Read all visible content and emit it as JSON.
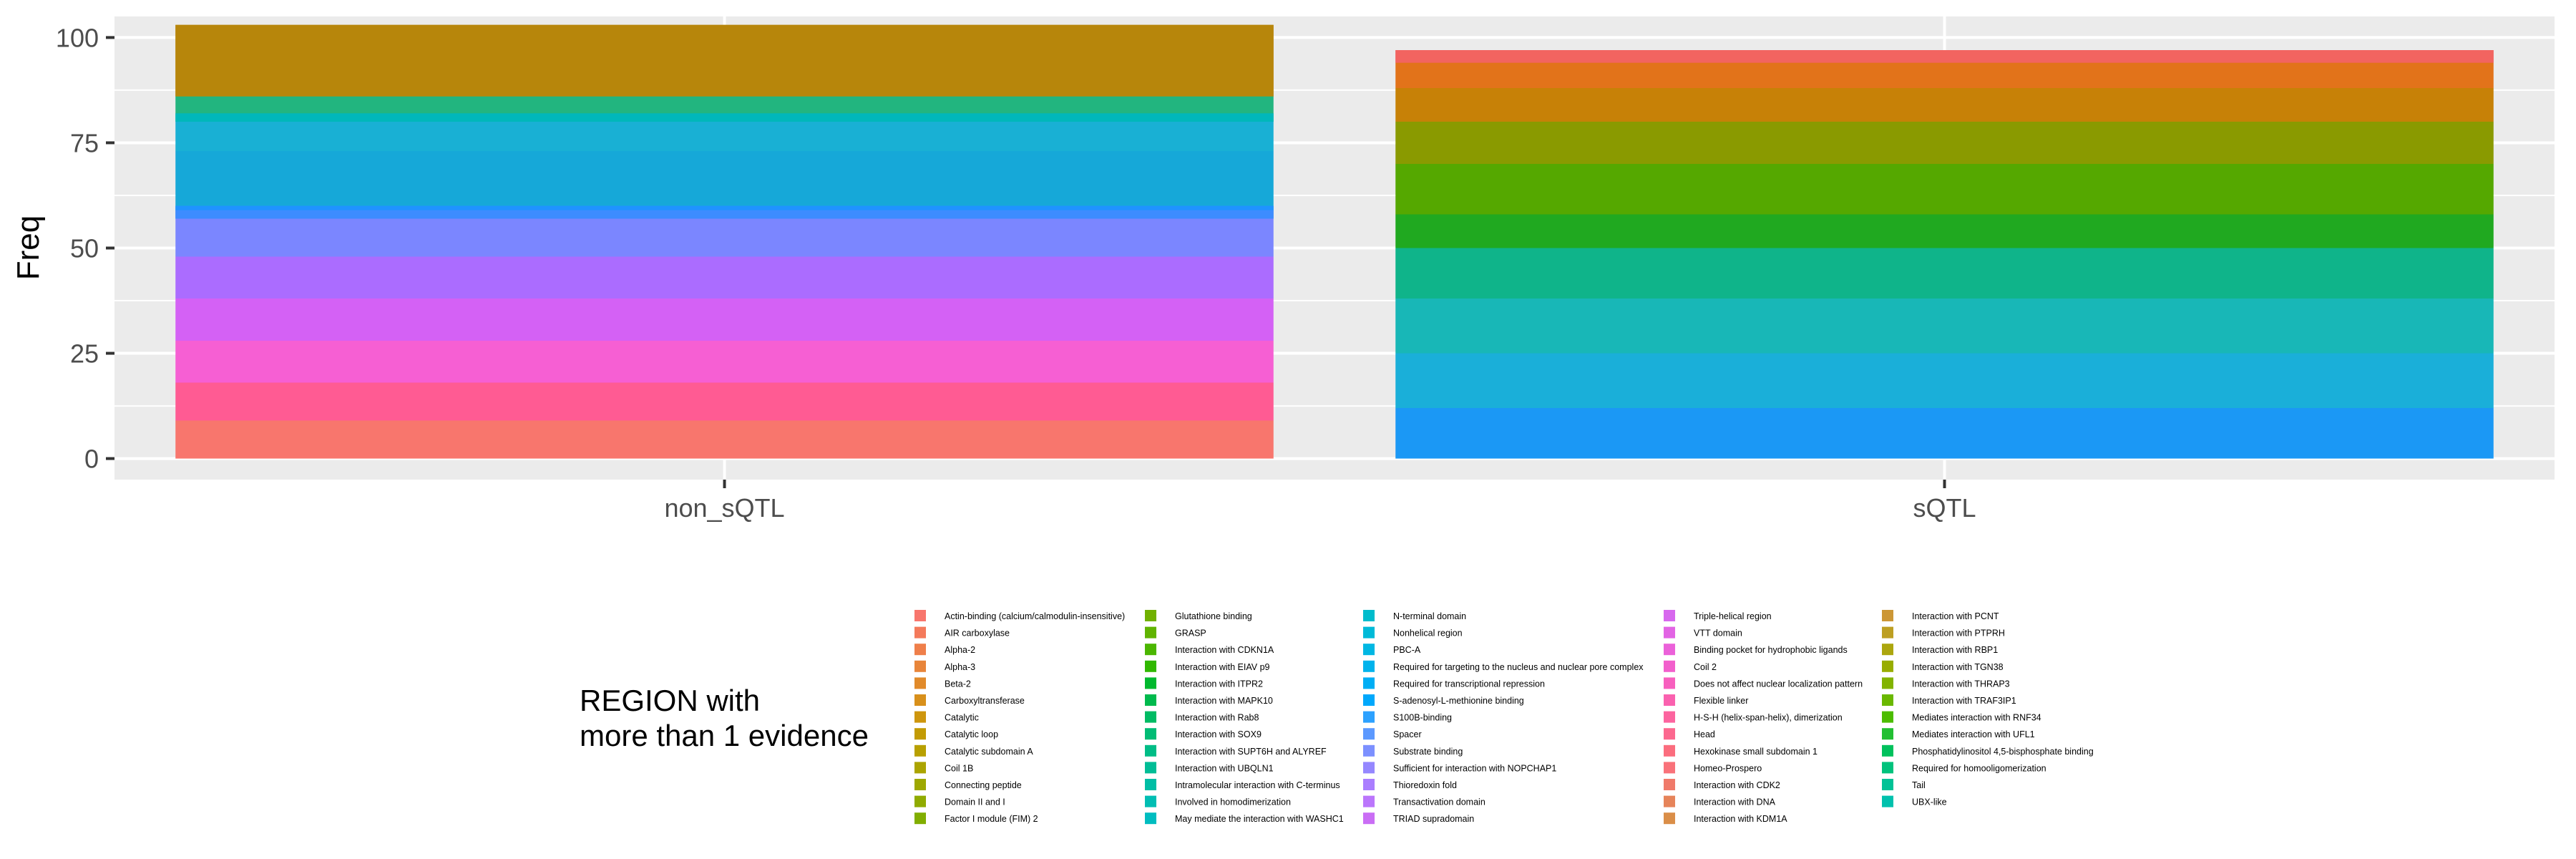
{
  "chart_data": {
    "type": "bar",
    "stacked": true,
    "title": "",
    "xlabel": "",
    "ylabel": "Freq",
    "ylim": [
      -5,
      105
    ],
    "yticks": [
      0,
      25,
      50,
      75,
      100
    ],
    "categories": [
      "non_sQTL",
      "sQTL"
    ],
    "totals": [
      103,
      97
    ],
    "grid": true,
    "legend_position": "bottom",
    "legend_title": "REGION with\nmore than 1 evidence",
    "legend_entries": [
      "Actin-binding (calcium/calmodulin-insensitive)",
      "AIR carboxylase",
      "Alpha-2",
      "Alpha-3",
      "Beta-2",
      "Carboxyltransferase",
      "Catalytic",
      "Catalytic loop",
      "Catalytic subdomain A",
      "Coil 1B",
      "Connecting peptide",
      "Domain II and I",
      "Factor I module (FIM) 2",
      "Glutathione binding",
      "GRASP",
      "Interaction with CDKN1A",
      "Interaction with EIAV p9",
      "Interaction with ITPR2",
      "Interaction with MAPK10",
      "Interaction with Rab8",
      "Interaction with SOX9",
      "Interaction with SUPT6H and ALYREF",
      "Interaction with UBQLN1",
      "Intramolecular interaction with C-terminus",
      "Involved in homodimerization",
      "May mediate the interaction with WASHC1",
      "N-terminal domain",
      "Nonhelical region",
      "PBC-A",
      "Required for targeting to the nucleus and nuclear pore complex",
      "Required for transcriptional repression",
      "S-adenosyl-L-methionine binding",
      "S100B-binding",
      "Spacer",
      "Substrate binding",
      "Sufficient for interaction with NOPCHAP1",
      "Thioredoxin fold",
      "Transactivation domain",
      "TRIAD supradomain",
      "Triple-helical region",
      "VTT domain",
      "Binding pocket for hydrophobic ligands",
      "Coil 2",
      "Does not affect nuclear localization pattern",
      "Flexible linker",
      "H-S-H (helix-span-helix), dimerization",
      "Head",
      "Hexokinase small subdomain 1",
      "Homeo-Prospero",
      "Interaction with CDK2",
      "Interaction with DNA",
      "Interaction with KDM1A",
      "Interaction with PCNT",
      "Interaction with PTPRH",
      "Interaction with RBP1",
      "Interaction with TGN38",
      "Interaction with THRAP3",
      "Interaction with TRAF3IP1",
      "Mediates interaction with RNF34",
      "Mediates interaction with UFL1",
      "Phosphatidylinositol 4,5-bisphosphate binding",
      "Required for homooligomerization",
      "Tail",
      "UBX-like"
    ],
    "legend_colors": [
      "#F8766D",
      "#F47A5B",
      "#EF7F4A",
      "#E8853A",
      "#E18A2A",
      "#D8901B",
      "#CE960D",
      "#C39B04",
      "#B8A000",
      "#ABA400",
      "#9EA800",
      "#90AB00",
      "#81AE00",
      "#71B100",
      "#60B400",
      "#4BB600",
      "#30B800",
      "#00B92E",
      "#00BA4D",
      "#00BB63",
      "#00BC75",
      "#00BD86",
      "#00BD96",
      "#00BEA5",
      "#00BEB3",
      "#00BDC0",
      "#00BCCC",
      "#00BAD8",
      "#00B7E3",
      "#00B3EC",
      "#00AEF5",
      "#00A8FC",
      "#2CA1FF",
      "#5C99FF",
      "#7C90FF",
      "#9587FF",
      "#AA7EFF",
      "#BB76FC",
      "#CA6EF5",
      "#D768EE",
      "#E264E4",
      "#EB61D9",
      "#F25FCC",
      "#F75FBE",
      "#FA61AF",
      "#FC649F",
      "#FC688F",
      "#FB6D7E",
      "#F9727A",
      "#F07A6A",
      "#E6845A",
      "#DA8E48",
      "#CC9736",
      "#BD9F22",
      "#ACA60E",
      "#98AD00",
      "#82B300",
      "#6AB800",
      "#4CBC00",
      "#22BF32",
      "#00C15C",
      "#00C27C",
      "#00C296",
      "#00C1AD"
    ],
    "segments": {
      "non_sQTL": [
        {
          "from": 0,
          "to": 9,
          "color": "#F8766D"
        },
        {
          "from": 9,
          "to": 18,
          "color": "#FF5B93"
        },
        {
          "from": 18,
          "to": 28,
          "color": "#F65FD3"
        },
        {
          "from": 28,
          "to": 38,
          "color": "#D461F5"
        },
        {
          "from": 38,
          "to": 48,
          "color": "#AB6CFF"
        },
        {
          "from": 48,
          "to": 57,
          "color": "#7B86FF"
        },
        {
          "from": 57,
          "to": 59,
          "color": "#3D8CFF"
        },
        {
          "from": 59,
          "to": 60,
          "color": "#1F93FF"
        },
        {
          "from": 60,
          "to": 73,
          "color": "#16A8D8"
        },
        {
          "from": 73,
          "to": 80,
          "color": "#19B0D4"
        },
        {
          "from": 80,
          "to": 82,
          "color": "#00B7BA"
        },
        {
          "from": 82,
          "to": 86,
          "color": "#22B57F"
        },
        {
          "from": 86,
          "to": 103,
          "color": "#B7860B"
        }
      ],
      "sQTL": [
        {
          "from": 0,
          "to": 12,
          "color": "#1B98F5"
        },
        {
          "from": 12,
          "to": 25,
          "color": "#1AAFD9"
        },
        {
          "from": 25,
          "to": 38,
          "color": "#18B7B7"
        },
        {
          "from": 38,
          "to": 50,
          "color": "#0FB48A"
        },
        {
          "from": 50,
          "to": 58,
          "color": "#20A920"
        },
        {
          "from": 58,
          "to": 70,
          "color": "#55A800"
        },
        {
          "from": 70,
          "to": 80,
          "color": "#8A9A00"
        },
        {
          "from": 80,
          "to": 88,
          "color": "#C78107"
        },
        {
          "from": 88,
          "to": 94,
          "color": "#E2731A"
        },
        {
          "from": 94,
          "to": 97,
          "color": "#F26460"
        }
      ]
    }
  }
}
